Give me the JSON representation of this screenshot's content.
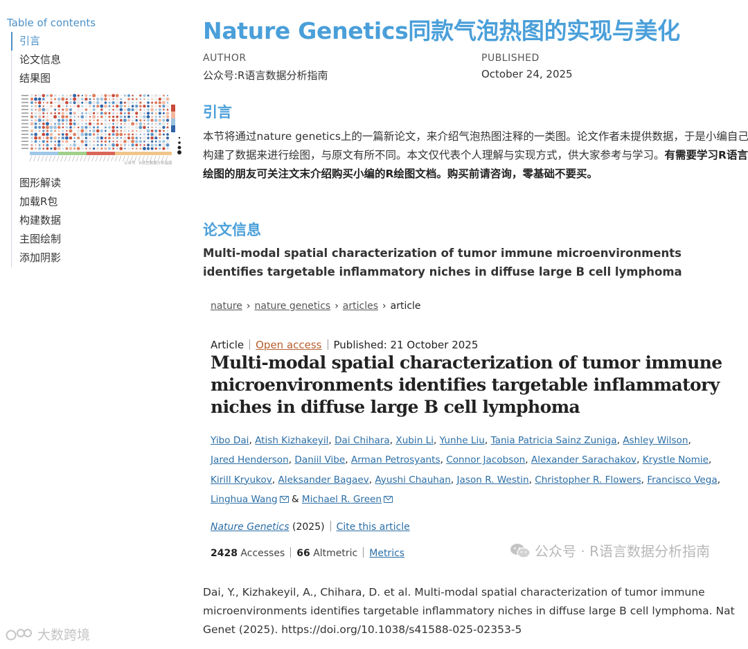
{
  "toc": {
    "title": "Table of contents",
    "items": [
      {
        "label": "引言"
      },
      {
        "label": "论文信息"
      },
      {
        "label": "结果图"
      },
      {
        "label": "图形解读"
      },
      {
        "label": "加载R包"
      },
      {
        "label": "构建数据"
      },
      {
        "label": "主图绘制"
      },
      {
        "label": "添加阴影"
      }
    ]
  },
  "header": {
    "title": "Nature Genetics同款气泡热图的实现与美化",
    "author_label": "AUTHOR",
    "author": "公众号:R语言数据分析指南",
    "published_label": "PUBLISHED",
    "published": "October 24, 2025"
  },
  "intro": {
    "heading": "引言",
    "text_plain": "本节将通过nature genetics上的一篇新论文，来介绍气泡热图注释的一类图。论文作者未提供数据，于是小编自己构建了数据来进行绘图，与原文有所不同。本文仅代表个人理解与实现方式，供大家参考与学习。",
    "text_bold": "有需要学习R语言绘图的朋友可关注文末介绍购买小编的R绘图文档。购买前请咨询，零基础不要买。"
  },
  "paper": {
    "heading": "论文信息",
    "title": "Multi-modal spatial characterization of tumor immune microenvironments identifies targetable inflammatory niches in diffuse large B cell lymphoma"
  },
  "article": {
    "breadcrumbs": [
      "nature",
      "nature genetics",
      "articles"
    ],
    "breadcrumb_current": "article",
    "type": "Article",
    "open_access": "Open access",
    "published": "Published: 21 October 2025",
    "title": "Multi-modal spatial characterization of tumor immune microenvironments identifies targetable inflammatory niches in diffuse large B  cell lymphoma",
    "authors": [
      "Yibo Dai",
      "Atish Kizhakeyil",
      "Dai Chihara",
      "Xubin Li",
      "Yunhe Liu",
      "Tania Patricia Sainz Zuniga",
      "Ashley Wilson",
      "Jared Henderson",
      "Daniil Vibe",
      "Arman Petrosyants",
      "Connor Jacobson",
      "Alexander Sarachakov",
      "Krystle Nomie",
      "Kirill Kryukov",
      "Aleksander Bagaev",
      "Ayushi Chauhan",
      "Jason R. Westin",
      "Christopher R. Flowers",
      "Francisco Vega",
      "Linghua Wang",
      "Michael R. Green"
    ],
    "journal": "Nature Genetics",
    "year": "(2025)",
    "cite": "Cite this article",
    "accesses_value": "2428",
    "accesses_label": "Accesses",
    "altmetric_value": "66",
    "altmetric_label": "Altmetric",
    "metrics_label": "Metrics"
  },
  "watermark": {
    "text": "公众号 · R语言数据分析指南",
    "corner": "大数跨境"
  },
  "citation": "Dai, Y., Kizhakeyil, A., Chihara, D. et al. Multi-modal spatial characterization of tumor immune microenvironments identifies targetable inflammatory niches in diffuse large B cell lymphoma. Nat Genet (2025). https://doi.org/10.1038/s41588-025-02353-5",
  "colors": {
    "accent": "#4a9fd9",
    "link": "#2b6ea6",
    "open_access": "#b75e2e"
  }
}
